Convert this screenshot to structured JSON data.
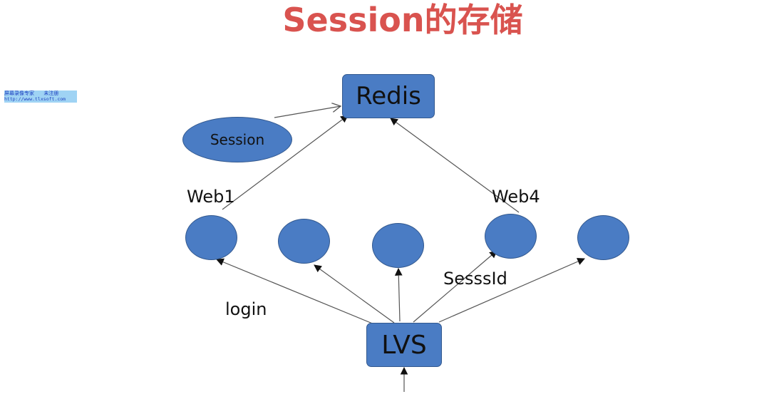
{
  "title": "Session的存储",
  "watermark": {
    "line1": "屏幕录像专家      未注册",
    "line2": "http://www.tlxsoft.com"
  },
  "nodes": {
    "redis": "Redis",
    "lvs": "LVS",
    "session": "Session"
  },
  "labels": {
    "web1": "Web1",
    "web4": "Web4",
    "login": "login",
    "sessid": "SesssId"
  },
  "colors": {
    "title": "#d9534f",
    "node_fill": "#4a7cc4",
    "node_border": "#33598f",
    "edge": "#555555"
  }
}
